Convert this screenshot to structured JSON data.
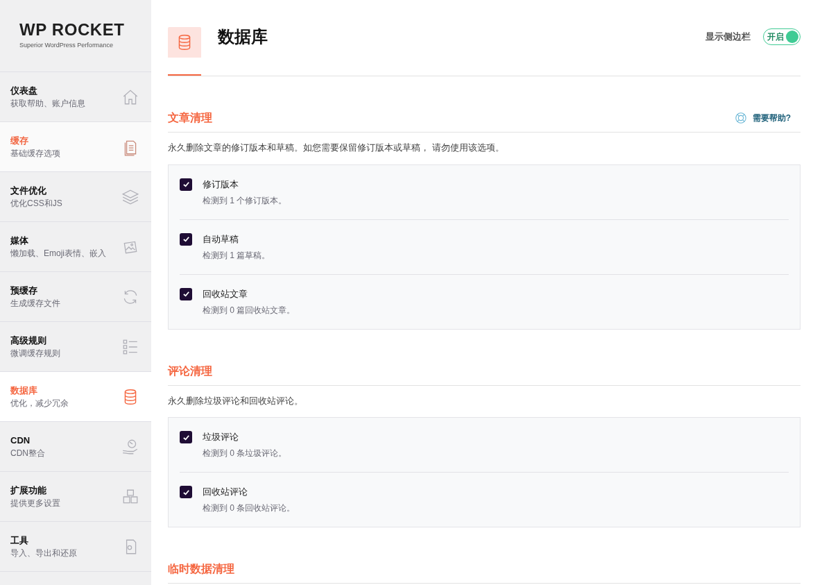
{
  "logo": {
    "name": "WP ROCKET",
    "tagline": "Superior WordPress Performance"
  },
  "sidebar": {
    "items": [
      {
        "kind": "home",
        "title": "仪表盘",
        "subtitle": "获取帮助、账户信息",
        "selected": false,
        "hovered": false
      },
      {
        "kind": "file",
        "title": "缓存",
        "subtitle": "基础缓存选项",
        "selected": false,
        "hovered": true
      },
      {
        "kind": "layers",
        "title": "文件优化",
        "subtitle": "优化CSS和JS",
        "selected": false,
        "hovered": false
      },
      {
        "kind": "image",
        "title": "媒体",
        "subtitle": "懒加载、Emoji表情、嵌入",
        "selected": false,
        "hovered": false
      },
      {
        "kind": "refresh",
        "title": "预缓存",
        "subtitle": "生成缓存文件",
        "selected": false,
        "hovered": false
      },
      {
        "kind": "list",
        "title": "高级规则",
        "subtitle": "微调缓存规则",
        "selected": false,
        "hovered": false
      },
      {
        "kind": "database",
        "title": "数据库",
        "subtitle": "优化，减少冗余",
        "selected": true,
        "hovered": false
      },
      {
        "kind": "globe",
        "title": "CDN",
        "subtitle": "CDN整合",
        "selected": false,
        "hovered": false
      },
      {
        "kind": "cubes",
        "title": "扩展功能",
        "subtitle": "提供更多设置",
        "selected": false,
        "hovered": false
      },
      {
        "kind": "gear",
        "title": "工具",
        "subtitle": "导入、导出和还原",
        "selected": false,
        "hovered": false
      }
    ]
  },
  "header": {
    "title": "数据库",
    "sidebar_toggle": {
      "label": "显示侧边栏",
      "state_text": "开启",
      "on": true
    }
  },
  "sections": [
    {
      "title": "文章清理",
      "help": "需要帮助?",
      "description": "永久删除文章的修订版本和草稿。如您需要保留修订版本或草稿， 请勿使用该选项。",
      "options": [
        {
          "label": "修订版本",
          "detail": "检测到 1 个修订版本。",
          "checked": true
        },
        {
          "label": "自动草稿",
          "detail": "检测到 1 篇草稿。",
          "checked": true
        },
        {
          "label": "回收站文章",
          "detail": "检测到 0 篇回收站文章。",
          "checked": true
        }
      ]
    },
    {
      "title": "评论清理",
      "description": "永久删除垃圾评论和回收站评论。",
      "options": [
        {
          "label": "垃圾评论",
          "detail": "检测到 0 条垃圾评论。",
          "checked": true
        },
        {
          "label": "回收站评论",
          "detail": "检测到 0 条回收站评论。",
          "checked": true
        }
      ]
    },
    {
      "title": "临时数据清理"
    }
  ]
}
